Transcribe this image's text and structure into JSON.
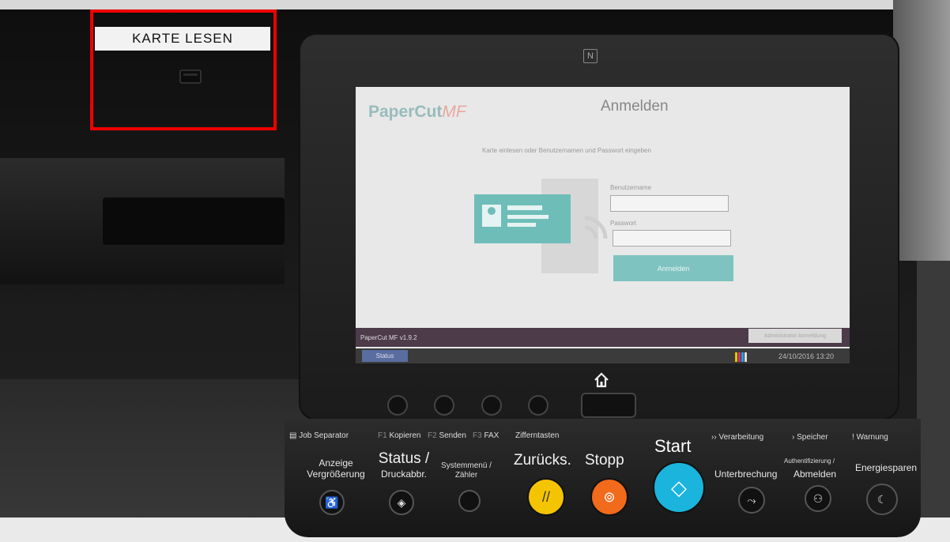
{
  "card_reader": {
    "label": "KARTE LESEN",
    "icon": "card-reader-icon",
    "highlight_color": "#e00000"
  },
  "panel": {
    "nfc_icon": "N",
    "home_icon": "home-icon"
  },
  "screen": {
    "brand_main": "PaperCut",
    "brand_suffix": "MF",
    "title": "Anmelden",
    "instruction": "Karte einlesen oder Benutzernamen und Passwort eingeben",
    "username_label": "Benutzername",
    "username_value": "",
    "password_label": "Passwort",
    "password_value": "",
    "login_button": "Anmelden",
    "version": "PaperCut MF v1.9.2",
    "admin_button": "Administrator Anmeldung",
    "status_tab": "Status",
    "datetime": "24/10/2016 13:20",
    "accent_color": "#7fc3c0"
  },
  "keys": {
    "job_separator": "Job Separator",
    "f1": "F1",
    "kopieren": "Kopieren",
    "f2": "F2",
    "senden": "Senden",
    "f3": "F3",
    "fax": "FAX",
    "zifferntasten": "Zifferntasten",
    "anzeige_line1": "Anzeige",
    "anzeige_line2": "Vergrößerung",
    "status_line1": "Status /",
    "status_line2": "Druckabbr.",
    "systemmenu_line1": "Systemmenü /",
    "systemmenu_line2": "Zähler",
    "zuruecks": "Zurücks.",
    "stopp": "Stopp",
    "start": "Start",
    "verarbeitung": "Verarbeitung",
    "speicher": "Speicher",
    "warnung": "Warnung",
    "unterbrechung": "Unterbrechung",
    "auth_line1": "Authentifizierung /",
    "auth_line2": "Abmelden",
    "energiesparen": "Energiesparen",
    "colors": {
      "zuruecks": "#f5c400",
      "stopp": "#f26a1b",
      "start": "#1ab4dc"
    }
  }
}
